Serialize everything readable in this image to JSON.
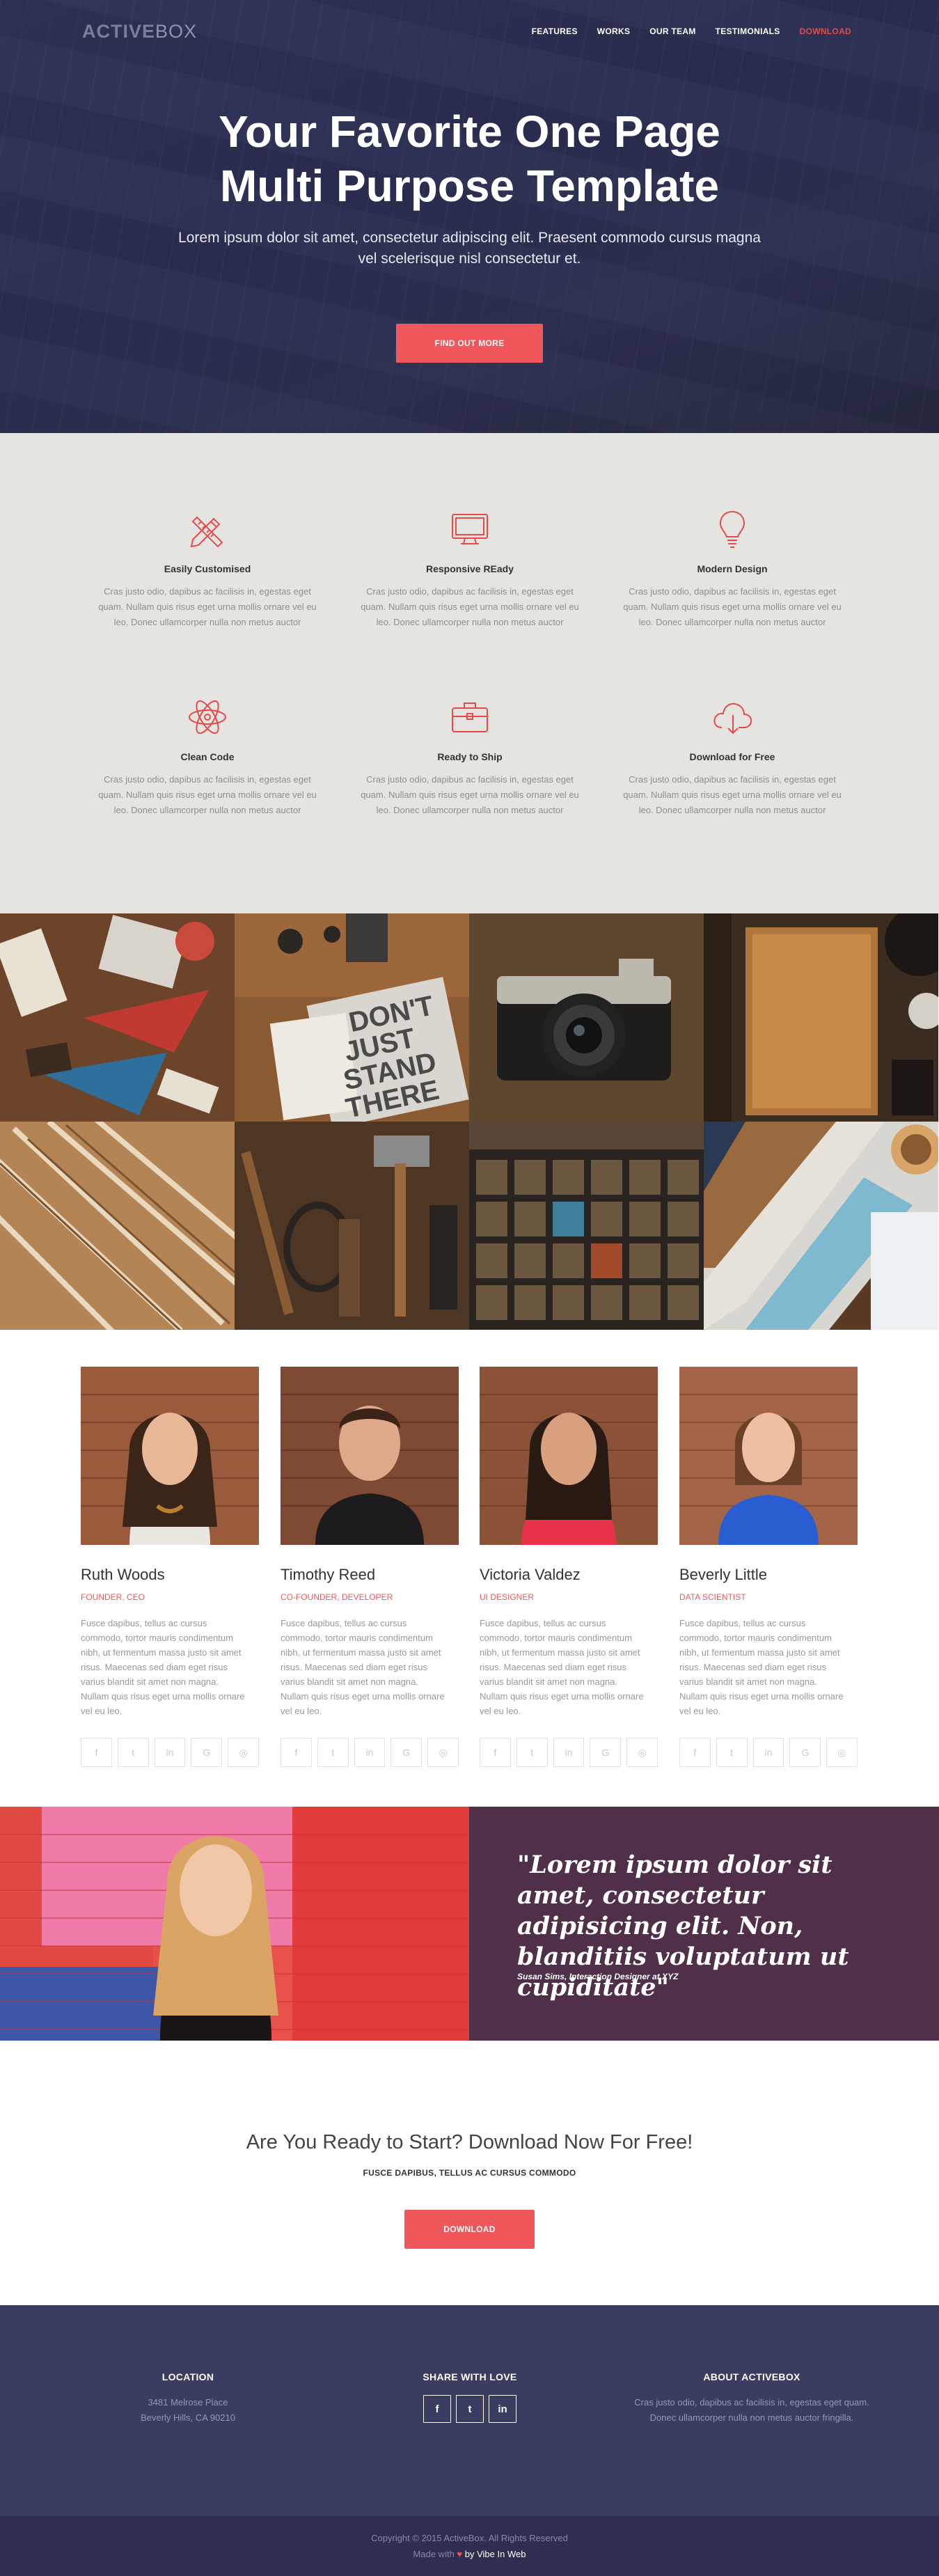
{
  "brand": {
    "logo_bold": "ACTIVE",
    "logo_light": "BOX",
    "accent": "#f0575b",
    "hero_bg": "#2f3355"
  },
  "nav": {
    "items": [
      "FEATURES",
      "WORKS",
      "OUR TEAM",
      "TESTIMONIALS",
      "DOWNLOAD"
    ]
  },
  "hero": {
    "title_line1": "Your Favorite One Page",
    "title_line2": "Multi Purpose Template",
    "subtitle": "Lorem ipsum dolor sit amet, consectetur adipiscing elit. Praesent commodo cursus magna vel scelerisque nisl consectetur et.",
    "button": "FIND OUT MORE"
  },
  "features": {
    "items": [
      {
        "icon": "pencil-ruler-icon",
        "title": "Easily Customised",
        "text": "Cras justo odio, dapibus ac facilisis in, egestas eget quam. Nullam quis risus eget urna mollis ornare vel eu leo. Donec ullamcorper nulla non metus auctor"
      },
      {
        "icon": "monitor-icon",
        "title": "Responsive REady",
        "text": "Cras justo odio, dapibus ac facilisis in, egestas eget quam. Nullam quis risus eget urna mollis ornare vel eu leo. Donec ullamcorper nulla non metus auctor"
      },
      {
        "icon": "lightbulb-icon",
        "title": "Modern Design",
        "text": "Cras justo odio, dapibus ac facilisis in, egestas eget quam. Nullam quis risus eget urna mollis ornare vel eu leo. Donec ullamcorper nulla non metus auctor"
      },
      {
        "icon": "atom-icon",
        "title": "Clean Code",
        "text": "Cras justo odio, dapibus ac facilisis in, egestas eget quam. Nullam quis risus eget urna mollis ornare vel eu leo. Donec ullamcorper nulla non metus auctor"
      },
      {
        "icon": "briefcase-icon",
        "title": "Ready to Ship",
        "text": "Cras justo odio, dapibus ac facilisis in, egestas eget quam. Nullam quis risus eget urna mollis ornare vel eu leo. Donec ullamcorper nulla non metus auctor"
      },
      {
        "icon": "cloud-download-icon",
        "title": "Download for Free",
        "text": "Cras justo odio, dapibus ac facilisis in, egestas eget quam. Nullam quis risus eget urna mollis ornare vel eu leo. Donec ullamcorper nulla non metus auctor"
      }
    ]
  },
  "gallery": {
    "tiles": [
      {
        "name": "pennants-photo"
      },
      {
        "name": "dont-just-stand-photo"
      },
      {
        "name": "camera-photo"
      },
      {
        "name": "notebook-photo"
      },
      {
        "name": "pencils-photo"
      },
      {
        "name": "tools-photo"
      },
      {
        "name": "letterpress-photo"
      },
      {
        "name": "coffee-wood-photo"
      }
    ],
    "sign_text": "DON'T JUST STAND THERE"
  },
  "team": {
    "members": [
      {
        "name": "Ruth Woods",
        "role": "FOUNDER, CEO",
        "bio": "Fusce dapibus, tellus ac cursus commodo, tortor mauris condimentum nibh, ut fermentum massa justo sit amet risus. Maecenas sed diam eget risus varius blandit sit amet non magna. Nullam quis risus eget urna mollis ornare vel eu leo."
      },
      {
        "name": "Timothy Reed",
        "role": "CO-FOUNDER, DEVELOPER",
        "bio": "Fusce dapibus, tellus ac cursus commodo, tortor mauris condimentum nibh, ut fermentum massa justo sit amet risus. Maecenas sed diam eget risus varius blandit sit amet non magna. Nullam quis risus eget urna mollis ornare vel eu leo."
      },
      {
        "name": "Victoria Valdez",
        "role": "UI DESIGNER",
        "bio": "Fusce dapibus, tellus ac cursus commodo, tortor mauris condimentum nibh, ut fermentum massa justo sit amet risus. Maecenas sed diam eget risus varius blandit sit amet non magna. Nullam quis risus eget urna mollis ornare vel eu leo."
      },
      {
        "name": "Beverly Little",
        "role": "DATA SCIENTIST",
        "bio": "Fusce dapibus, tellus ac cursus commodo, tortor mauris condimentum nibh, ut fermentum massa justo sit amet risus. Maecenas sed diam eget risus varius blandit sit amet non magna. Nullam quis risus eget urna mollis ornare vel eu leo."
      }
    ],
    "social_glyphs": {
      "facebook": "f",
      "twitter": "t",
      "linkedin": "in",
      "google": "G",
      "dribbble": "◎"
    }
  },
  "testimonial": {
    "quote": "\"Lorem ipsum dolor sit amet, consectetur adipisicing elit. Non, blanditiis voluptatum ut cupiditate\"",
    "author": "Susan Sims, Interaction Designer at XYZ"
  },
  "cta": {
    "title": "Are You Ready to Start? Download Now For Free!",
    "subtitle": "FUSCE DAPIBUS, TELLUS AC CURSUS COMMODO",
    "button": "DOWNLOAD"
  },
  "footer": {
    "location_title": "LOCATION",
    "address_line1": "3481 Melrose Place",
    "address_line2": "Beverly Hills, CA 90210",
    "share_title": "SHARE WITH LOVE",
    "share_glyphs": [
      "f",
      "t",
      "in"
    ],
    "about_title": "ABOUT ACTIVEBOX",
    "about_text": "Cras justo odio, dapibus ac facilisis in, egestas eget quam. Donec ullamcorper nulla non metus auctor fringilla.",
    "copyright": "Copyright © 2015 ActiveBox. All Rights Reserved",
    "made_with": "Made with",
    "heart": "♥",
    "by": "by Vibe In Web"
  }
}
